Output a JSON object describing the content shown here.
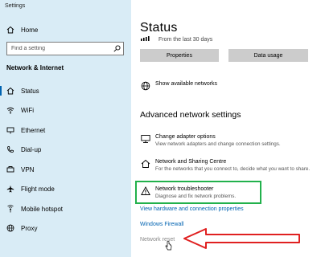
{
  "window": {
    "title": "Settings"
  },
  "sidebar": {
    "home_label": "Home",
    "search_placeholder": "Find a setting",
    "section_title": "Network & Internet",
    "items": [
      {
        "label": "Status",
        "icon": "home-network-icon",
        "active": true
      },
      {
        "label": "WiFi",
        "icon": "wifi-icon"
      },
      {
        "label": "Ethernet",
        "icon": "ethernet-icon"
      },
      {
        "label": "Dial-up",
        "icon": "dialup-icon"
      },
      {
        "label": "VPN",
        "icon": "vpn-icon"
      },
      {
        "label": "Flight mode",
        "icon": "airplane-icon"
      },
      {
        "label": "Mobile hotspot",
        "icon": "hotspot-icon"
      },
      {
        "label": "Proxy",
        "icon": "globe-icon"
      }
    ]
  },
  "main": {
    "title": "Status",
    "usage_text": "From the last 30 days",
    "properties_button": "Properties",
    "data_usage_button": "Data usage",
    "show_networks": "Show available networks",
    "advanced_heading": "Advanced network settings",
    "adapter_title": "Change adapter options",
    "adapter_desc": "View network adapters and change connection settings.",
    "sharing_title": "Network and Sharing Centre",
    "sharing_desc": "For the networks that you connect to, decide what you want to share.",
    "troubleshooter_title": "Network troubleshooter",
    "troubleshooter_desc": "Diagnose and fix network problems.",
    "link_hardware": "View hardware and connection properties",
    "link_firewall": "Windows Firewall",
    "link_reset": "Network reset"
  },
  "colors": {
    "sidebar_bg": "#d9ecf6",
    "link": "#0063b1",
    "highlight_box": "#22b14c",
    "arrow": "#e02020",
    "button_bg": "#cccccc"
  }
}
